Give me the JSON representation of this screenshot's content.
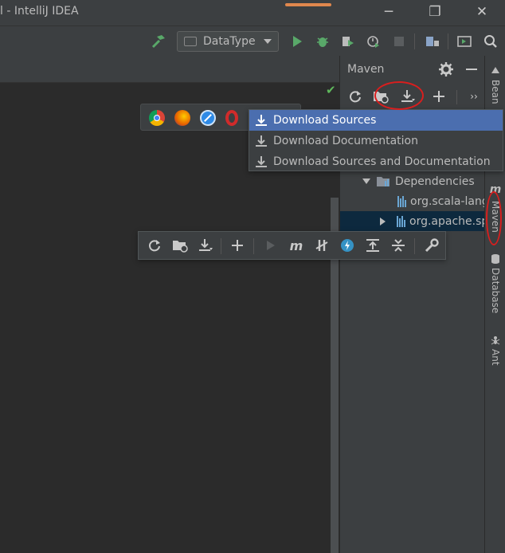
{
  "window": {
    "title": "l - IntelliJ IDEA"
  },
  "toolbar": {
    "run_config_label": "DataType"
  },
  "maven": {
    "title": "Maven",
    "tree": [
      {
        "label": "Dependencies",
        "expanded": true
      },
      {
        "label": "org.scala-lang"
      },
      {
        "label": "org.apache.sp"
      }
    ]
  },
  "download_menu": {
    "items": [
      {
        "label": "Download Sources",
        "selected": true
      },
      {
        "label": "Download Documentation"
      },
      {
        "label": "Download Sources and Documentation"
      }
    ]
  },
  "right_stripe": {
    "tabs": [
      "Bean",
      "Maven",
      "Database",
      "Ant"
    ],
    "maven_letter": "m"
  },
  "colors": {
    "accent": "#e0874d",
    "selection": "#4b6eaf",
    "annotation": "#d81e1e",
    "run_green": "#59a869"
  }
}
